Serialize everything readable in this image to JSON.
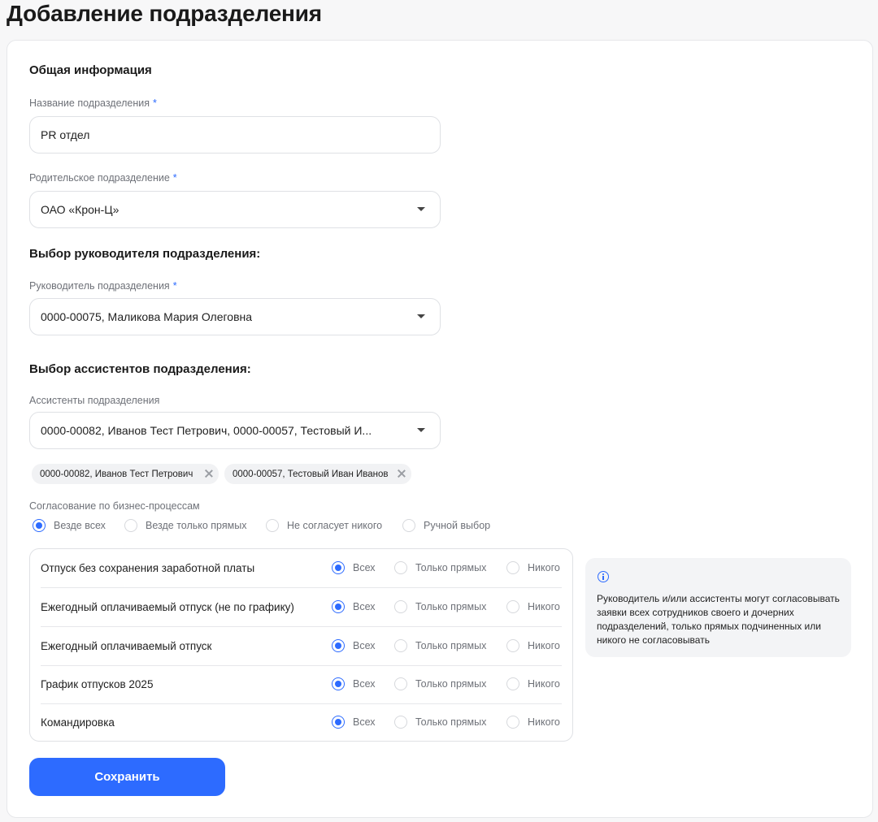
{
  "page": {
    "title": "Добавление подразделения"
  },
  "general": {
    "title": "Общая информация",
    "name_label": "Название подразделения",
    "name_value": "PR отдел",
    "parent_label": "Родительское подразделение",
    "parent_value": "ОАО «Крон-Ц»",
    "required_mark": "*"
  },
  "manager": {
    "title": "Выбор руководителя подразделения:",
    "label": "Руководитель подразделения",
    "value": "0000-00075, Маликова Мария Олеговна"
  },
  "assistants": {
    "title": "Выбор ассистентов подразделения:",
    "label": "Ассистенты подразделения",
    "value": "0000-00082, Иванов Тест Петрович, 0000-00057, Тестовый И...",
    "chips": [
      "0000-00082, Иванов Тест Петрович",
      "0000-00057, Тестовый Иван Иванов"
    ]
  },
  "approval": {
    "label": "Согласование по бизнес-процессам",
    "options": [
      "Везде всех",
      "Везде только прямых",
      "Не согласует никого",
      "Ручной выбор"
    ],
    "selected": "Везде всех"
  },
  "processes": {
    "columns": [
      "Всех",
      "Только прямых",
      "Никого"
    ],
    "rows": [
      {
        "name": "Отпуск без сохранения заработной платы",
        "selected": "Всех"
      },
      {
        "name": "Ежегодный оплачиваемый отпуск (не по графику)",
        "selected": "Всех"
      },
      {
        "name": "Ежегодный оплачиваемый отпуск",
        "selected": "Всех"
      },
      {
        "name": "График отпусков 2025",
        "selected": "Всех"
      },
      {
        "name": "Командировка",
        "selected": "Всех"
      }
    ]
  },
  "info": {
    "icon": "info-icon",
    "text": "Руководитель и/или ассистенты могут согласовывать заявки всех сотрудников своего и дочерних подразделений, только прямых подчиненных или никого не согласовывать"
  },
  "actions": {
    "save_label": "Сохранить"
  },
  "colors": {
    "accent": "#2d6bff",
    "border": "#dfe1e5",
    "background": "#f7f7f8"
  }
}
